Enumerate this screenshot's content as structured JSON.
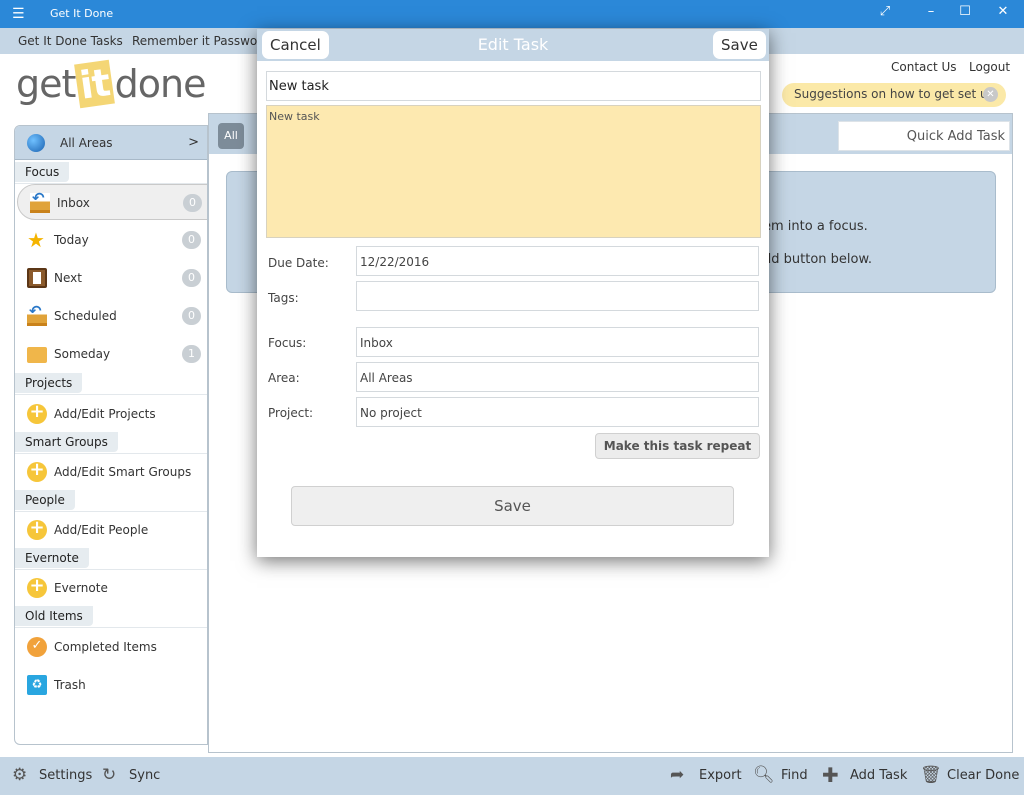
{
  "window": {
    "title": "Get It Done",
    "controls": [
      "⤢",
      "–",
      "☐",
      "✕"
    ]
  },
  "menu": {
    "items": [
      "Get It Done Tasks",
      "Remember it Passwords"
    ]
  },
  "header": {
    "logo_left": "get",
    "logo_it": "it",
    "logo_right": "done",
    "contact": "Contact Us",
    "logout": "Logout",
    "suggestion": "Suggestions on how to get set up"
  },
  "sidebar": {
    "areas_label": "All Areas",
    "areas_arrow": ">",
    "sections": {
      "focus": "Focus",
      "projects": "Projects",
      "smart_groups": "Smart Groups",
      "people": "People",
      "evernote": "Evernote",
      "old_items": "Old Items"
    },
    "focus_items": [
      {
        "label": "Inbox",
        "count": "0",
        "icon": "inbox-icon"
      },
      {
        "label": "Today",
        "count": "0",
        "icon": "star-icon"
      },
      {
        "label": "Next",
        "count": "0",
        "icon": "book-icon"
      },
      {
        "label": "Scheduled",
        "count": "0",
        "icon": "scheduled-icon"
      },
      {
        "label": "Someday",
        "count": "1",
        "icon": "folder-icon"
      }
    ],
    "add_projects": "Add/Edit Projects",
    "add_smart_groups": "Add/Edit Smart Groups",
    "add_people": "Add/Edit People",
    "evernote_item": "Evernote",
    "completed_items": "Completed Items",
    "trash": "Trash"
  },
  "main": {
    "all_button": "All",
    "quick_add": "Quick Add Task",
    "info_line1": "em into a focus.",
    "info_line2": "dd button below."
  },
  "bottom": {
    "settings": "Settings",
    "sync": "Sync",
    "export": "Export",
    "find": "Find",
    "add_task": "Add Task",
    "clear_done": "Clear Done"
  },
  "modal": {
    "title": "Edit Task",
    "cancel": "Cancel",
    "save_top": "Save",
    "task_name": "New task",
    "notes": "New task",
    "due_label": "Due Date:",
    "due_value": "12/22/2016",
    "tags_label": "Tags:",
    "tags_value": "",
    "focus_label": "Focus:",
    "focus_value": "Inbox",
    "area_label": "Area:",
    "area_value": "All Areas",
    "project_label": "Project:",
    "project_value": "No project",
    "repeat_button": "Make this task repeat",
    "save_bottom": "Save"
  }
}
